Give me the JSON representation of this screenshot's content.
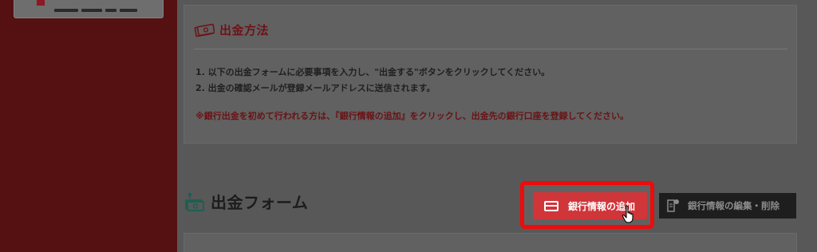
{
  "section": {
    "title": "出金方法",
    "steps": [
      "1. 以下の出金フォームに必要事項を入力し、\"出金する\"ボタンをクリックしてください。",
      "2. 出金の確認メールが登録メールアドレスに送信されます。"
    ],
    "notice": "※銀行出金を初めて行われる方は、『銀行情報の追加』をクリックし、出金先の銀行口座を登録してください。"
  },
  "form": {
    "title": "出金フォーム",
    "add_bank_label": "銀行情報の追加",
    "edit_bank_label": "銀行情報の編集・削除"
  },
  "colors": {
    "sidebar": "#551012",
    "accent": "#d0353a",
    "highlight": "#f00a0a",
    "notice_text": "#6a1215"
  },
  "icons": [
    "money-icon",
    "withdraw-form-icon",
    "credit-card-icon",
    "pointer-cursor-icon",
    "document-edit-icon"
  ]
}
